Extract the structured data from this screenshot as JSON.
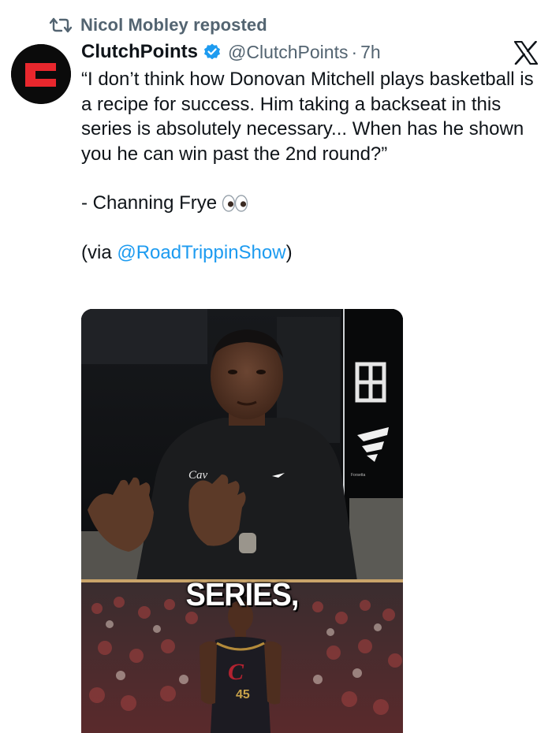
{
  "repost": {
    "icon": "repost-icon",
    "text": "Nicol Mobley reposted"
  },
  "author": {
    "display_name": "ClutchPoints",
    "verified": true,
    "handle": "@ClutchPoints",
    "separator": "·",
    "time": "7h",
    "avatar_letter": "C",
    "avatar_color": "#e8272d"
  },
  "brand": {
    "logo": "x-logo"
  },
  "tweet": {
    "quote": "“I don’t think how Donovan Mitchell plays basketball is a recipe for success. Him taking a backseat in this series is absolutely necessary... When has he shown you he can win past the 2nd round?”",
    "attribution": "- Channing Frye",
    "attribution_emoji": "eyes-emoji",
    "via_prefix": "(via ",
    "via_mention": "@RoadTrippinShow",
    "via_suffix": ")"
  },
  "media": {
    "caption": "SERIES,",
    "watermark_label": "Forsetta",
    "jersey_letter": "C",
    "jersey_number": "45"
  },
  "colors": {
    "text": "#0f1419",
    "secondary": "#536471",
    "link": "#1d9bf0",
    "verified": "#1d9bf0"
  }
}
